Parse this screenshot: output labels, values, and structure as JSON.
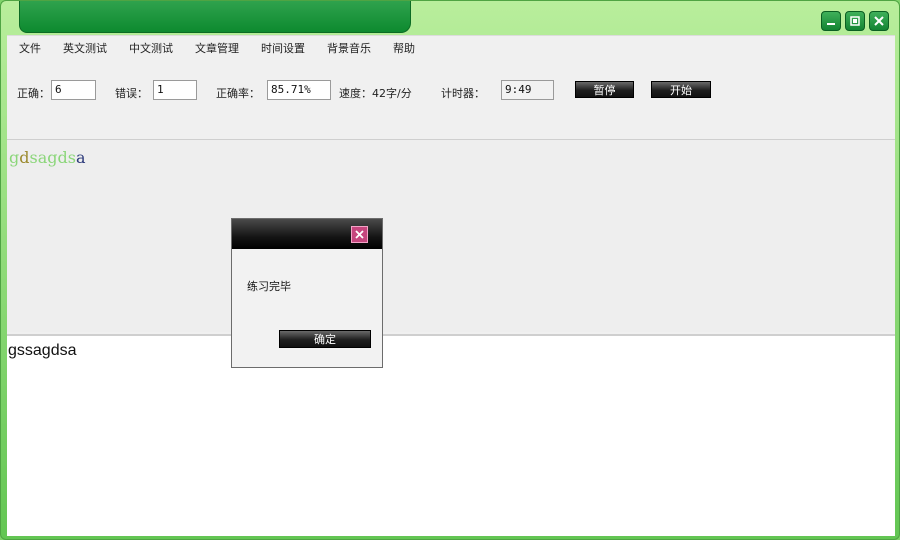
{
  "menu": [
    "文件",
    "英文测试",
    "中文测试",
    "文章管理",
    "时间设置",
    "背景音乐",
    "帮助"
  ],
  "stats": {
    "correct_label": "正确：",
    "correct_value": "6",
    "errors_label": "错误：",
    "errors_value": "1",
    "accuracy_label": "正确率：",
    "accuracy_value": "85.71%",
    "speed_label": "速度：42字/分",
    "timer_label": "计时器：",
    "timer_value": "9:49"
  },
  "buttons": {
    "pause": "暂停",
    "start": "开始"
  },
  "target_text": {
    "chars": [
      "g",
      "d",
      "s",
      "a",
      "g",
      "d",
      "s",
      "a"
    ],
    "colors": [
      "#8bd67a",
      "#9b8a2e",
      "#8bd67a",
      "#8bd67a",
      "#8bd67a",
      "#8bd67a",
      "#8bd67a",
      "#2c3a7a"
    ]
  },
  "input_text": "gssagdsa",
  "dialog": {
    "message": "练习完毕",
    "ok_label": "确定"
  },
  "colors": {
    "window_green": "#63c653",
    "title_green": "#0d8a2f",
    "dialog_close": "#c6467e"
  }
}
